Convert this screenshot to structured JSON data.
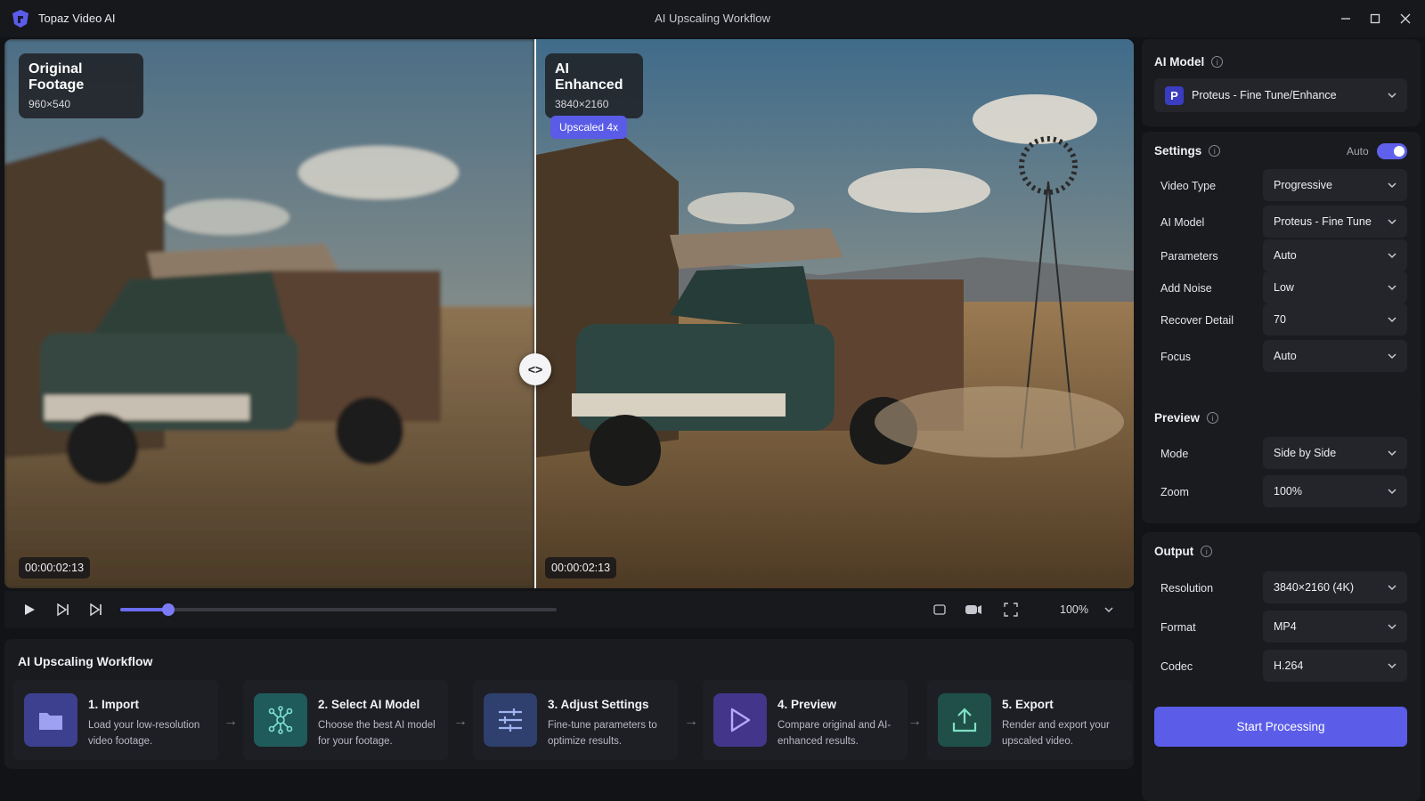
{
  "app": {
    "name": "Topaz Video AI",
    "window_title": "AI Upscaling Workflow"
  },
  "colors": {
    "accent": "#5b5de9",
    "panel": "#1a1b1f",
    "background": "#121316"
  },
  "viewer": {
    "left": {
      "title": "Original Footage",
      "resolution": "960×540",
      "timecode": "00:00:02:13"
    },
    "right": {
      "title": "AI Enhanced",
      "resolution": "3840×2160",
      "badge": "Upscaled 4x",
      "timecode": "00:00:02:13"
    },
    "divider_icon": "<>"
  },
  "playback": {
    "progress_fraction": 0.11,
    "zoom": "100%"
  },
  "workflow": {
    "title": "AI Upscaling Workflow",
    "steps": [
      {
        "name": "1. Import",
        "desc": "Load your low-resolution video footage.",
        "icon": "folder-icon",
        "color": "#3d3f8f"
      },
      {
        "name": "2. Select AI Model",
        "desc": "Choose the best AI model for your footage.",
        "icon": "network-icon",
        "color": "#1f5b5a"
      },
      {
        "name": "3. Adjust Settings",
        "desc": "Fine-tune parameters to optimize results.",
        "icon": "sliders-icon",
        "color": "#2f3f6e"
      },
      {
        "name": "4. Preview",
        "desc": "Compare original and AI-enhanced results.",
        "icon": "play-icon",
        "color": "#43358a"
      },
      {
        "name": "5. Export",
        "desc": "Render and export your upscaled video.",
        "icon": "upload-icon",
        "color": "#1f4f48"
      }
    ]
  },
  "panel": {
    "ai_model": {
      "heading": "AI Model",
      "selected": "Proteus - Fine Tune/Enhance",
      "letter": "P"
    },
    "settings": {
      "heading": "Settings",
      "auto_label": "Auto",
      "auto_on": true,
      "rows": [
        {
          "label": "Video Type",
          "value": "Progressive"
        },
        {
          "label": "AI Model",
          "value": "Proteus - Fine Tune"
        },
        {
          "label": "Parameters",
          "value": "Auto"
        },
        {
          "label": "Add Noise",
          "value": "Low"
        },
        {
          "label": "Recover Detail",
          "value": "70"
        },
        {
          "label": "Focus",
          "value": "Auto"
        }
      ]
    },
    "preview": {
      "heading": "Preview",
      "rows": [
        {
          "label": "Mode",
          "value": "Side by Side"
        },
        {
          "label": "Zoom",
          "value": "100%"
        }
      ]
    },
    "output": {
      "heading": "Output",
      "rows": [
        {
          "label": "Resolution",
          "value": "3840×2160 (4K)"
        },
        {
          "label": "Format",
          "value": "MP4"
        },
        {
          "label": "Codec",
          "value": "H.264"
        }
      ]
    },
    "start_button": "Start Processing"
  }
}
